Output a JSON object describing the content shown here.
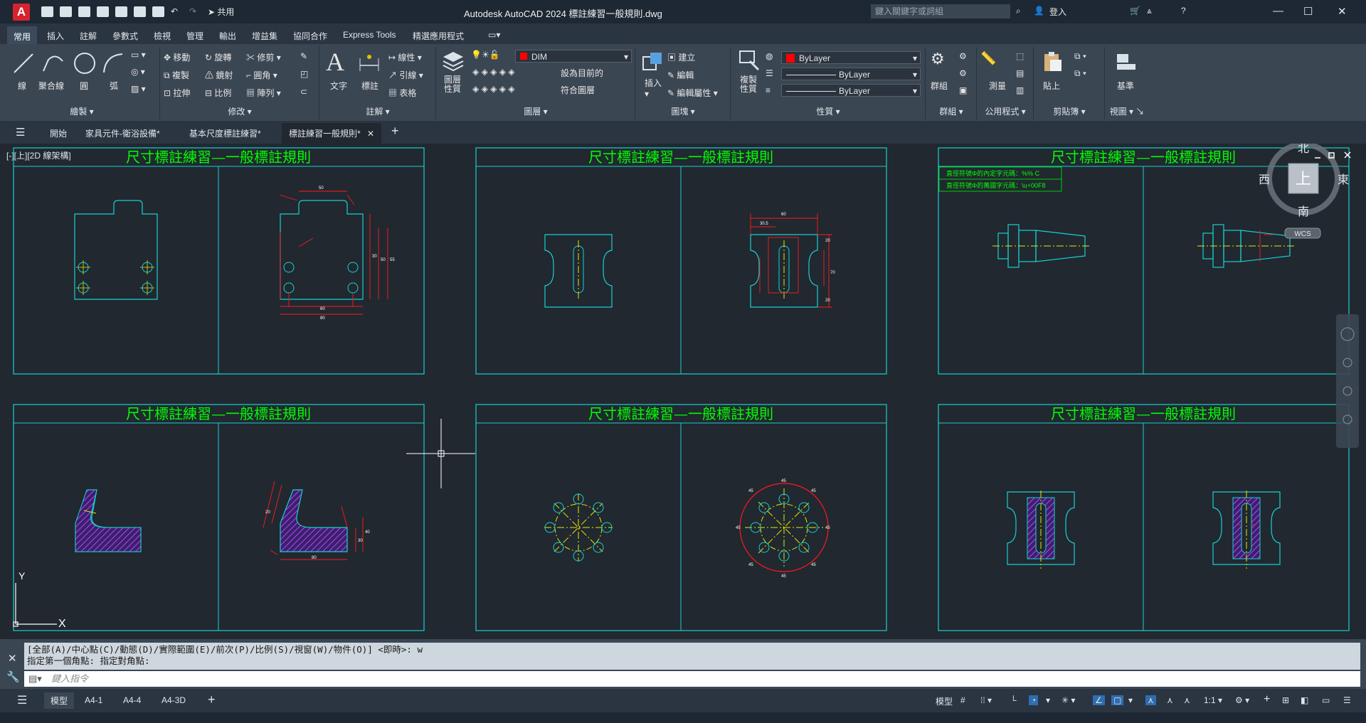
{
  "app": {
    "logo_letter": "A",
    "share_label": "共用",
    "title": "Autodesk AutoCAD 2024    標註練習一般規則.dwg",
    "search_placeholder": "鍵入關鍵字或詞組",
    "signin_label": "登入"
  },
  "ribbon_tabs": [
    "常用",
    "插入",
    "註解",
    "參數式",
    "檢視",
    "管理",
    "輸出",
    "增益集",
    "協同合作",
    "Express Tools",
    "精選應用程式"
  ],
  "ribbon": {
    "draw": {
      "title": "繪製",
      "line": "線",
      "polyline": "聚合線",
      "circle": "圓",
      "arc": "弧"
    },
    "modify": {
      "title": "修改",
      "move": "移動",
      "rotate": "旋轉",
      "trim": "修剪",
      "copy": "複製",
      "mirror": "鏡射",
      "fillet": "圓角",
      "stretch": "拉伸",
      "scale": "比例",
      "array": "陣列"
    },
    "annotation": {
      "title": "註解",
      "text": "文字",
      "dimension": "標註",
      "linear": "線性",
      "leader": "引線",
      "table": "表格"
    },
    "layers": {
      "title": "圖層",
      "properties": "圖層\n性質",
      "current_layer": "DIM",
      "set_current": "設為目前的",
      "match_layer": "符合圖層",
      "layer_color": "#ff0000"
    },
    "block": {
      "title": "圖塊",
      "insert": "插入",
      "create": "建立",
      "edit": "編輯",
      "edit_attr": "編輯屬性"
    },
    "properties": {
      "title": "性質",
      "match": "複製\n性質",
      "color": "ByLayer",
      "linetype": "ByLayer",
      "lineweight": "ByLayer",
      "color_swatch": "#ff0000"
    },
    "groups": {
      "title": "群組",
      "group": "群組"
    },
    "utilities": {
      "title": "公用程式",
      "measure": "測量"
    },
    "clipboard": {
      "title": "剪貼簿",
      "paste": "貼上"
    },
    "view": {
      "title": "視圖",
      "base": "基準"
    }
  },
  "file_tabs": [
    "開始",
    "家具元件-衛浴設備*",
    "基本尺度標註練習*",
    "標註練習一般規則*"
  ],
  "viewport_label": "[-][上][2D 線架構]",
  "frames": [
    {
      "title": "尺寸標註練習—一般標註規則"
    },
    {
      "title": "尺寸標註練習—一般標註規則"
    },
    {
      "title": "尺寸標註練習—一般標註規則"
    },
    {
      "title": "尺寸標註練習—一般標註規則"
    },
    {
      "title": "尺寸標註練習—一般標註規則"
    },
    {
      "title": "尺寸標註練習—一般標註規則"
    }
  ],
  "notes": [
    "直徑符號Φ的內定字元碼：%% C",
    "直徑符號Φ的萬國字元碼：\\u+00F8"
  ],
  "viewcube": {
    "north": "北",
    "south": "南",
    "east": "東",
    "west": "西",
    "top": "上",
    "wcs": "WCS"
  },
  "ucs": {
    "x": "X",
    "y": "Y"
  },
  "command": {
    "history_line1": "[全部(A)/中心點(C)/動態(D)/實際範圍(E)/前次(P)/比例(S)/視窗(W)/物件(O)] <即時>: w",
    "history_line2": "指定第一個角點: 指定對角點:",
    "input_placeholder": "鍵入指令"
  },
  "layout_tabs": [
    "模型",
    "A4-1",
    "A4-4",
    "A4-3D"
  ],
  "status": {
    "model": "模型",
    "scale": "1:1"
  },
  "colors": {
    "frame": "#18d0d0",
    "title": "#00ff00",
    "dim": "#ff1a1a",
    "center": "#e6e600",
    "hatch": "#8a2be2"
  }
}
